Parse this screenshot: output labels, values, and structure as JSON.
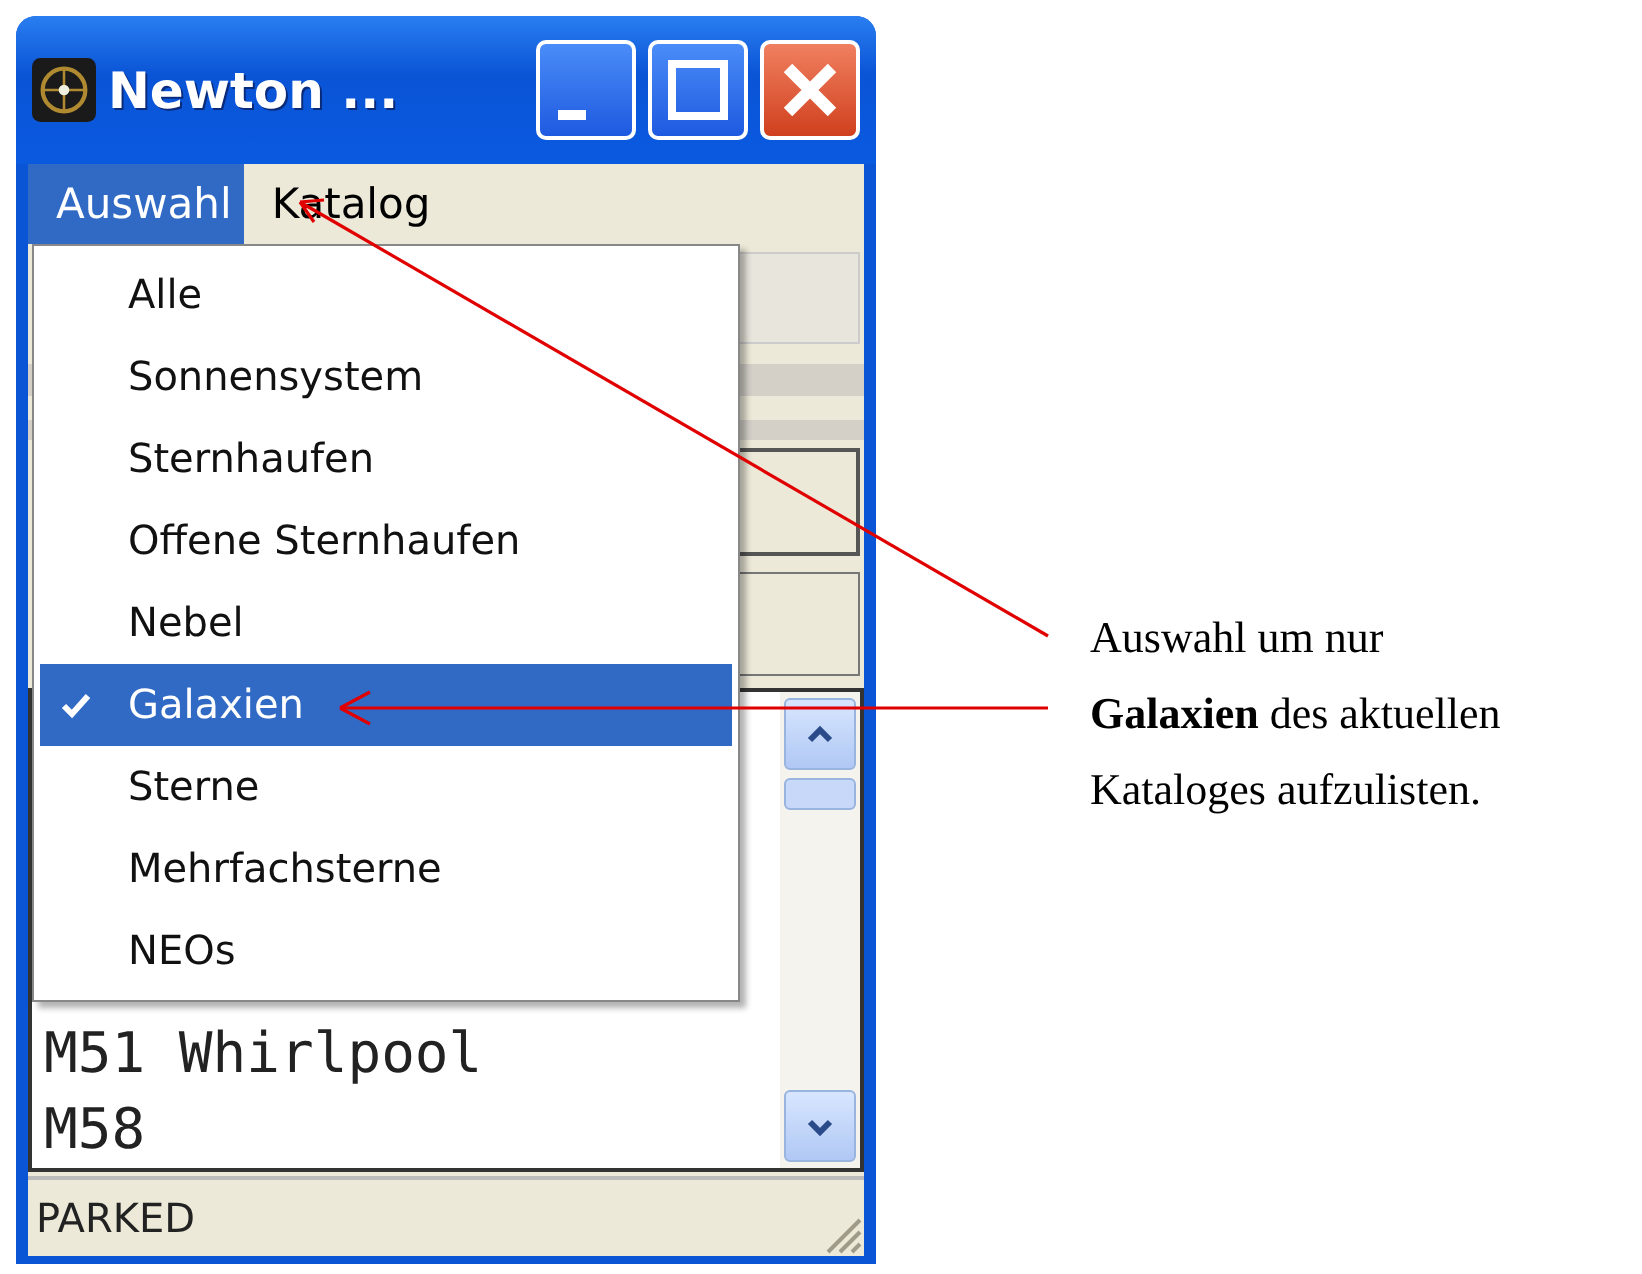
{
  "window": {
    "title": "Newton ..."
  },
  "menu_bar": [
    {
      "label": "Auswahl",
      "selected": true
    },
    {
      "label": "Katalog",
      "selected": false
    }
  ],
  "dropdown": [
    {
      "label": "Alle",
      "checked": false,
      "selected": false
    },
    {
      "label": "Sonnensystem",
      "checked": false,
      "selected": false
    },
    {
      "label": "Sternhaufen",
      "checked": false,
      "selected": false
    },
    {
      "label": "Offene Sternhaufen",
      "checked": false,
      "selected": false
    },
    {
      "label": "Nebel",
      "checked": false,
      "selected": false
    },
    {
      "label": "Galaxien",
      "checked": true,
      "selected": true
    },
    {
      "label": "Sterne",
      "checked": false,
      "selected": false
    },
    {
      "label": "Mehrfachsterne",
      "checked": false,
      "selected": false
    },
    {
      "label": "NEOs",
      "checked": false,
      "selected": false
    }
  ],
  "list": {
    "items": [
      "M51 Whirlpool",
      "M58"
    ]
  },
  "status_bar": "PARKED",
  "annotation": [
    "Auswahl um nur",
    "**Galaxien** des aktuellen",
    "Kataloges aufzulisten."
  ]
}
